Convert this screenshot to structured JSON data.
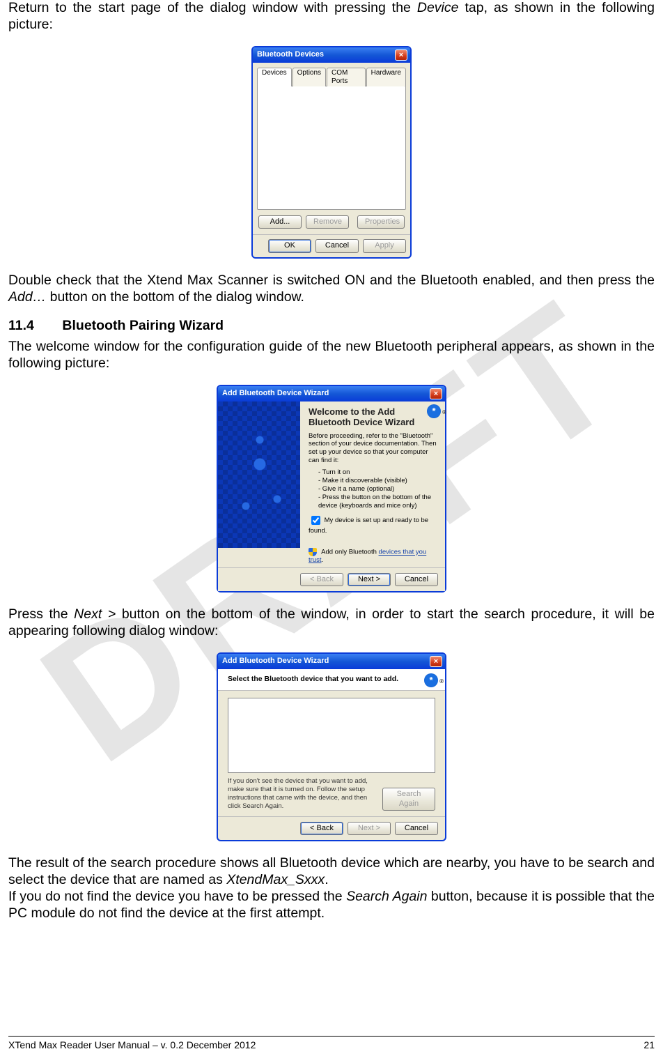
{
  "paragraphs": {
    "p1a": "Return to the start page of the dialog window with pressing the ",
    "p1b": "Device",
    "p1c": " tap, as shown in the following picture:",
    "p2a": "Double check that the Xtend Max Scanner is switched ON and the Bluetooth enabled, and then press the ",
    "p2b": "Add…",
    "p2c": " button on the bottom of the dialog window.",
    "p3": "The welcome window for the configuration guide of the new Bluetooth peripheral appears, as shown in the following picture:",
    "p4a": "Press the ",
    "p4b": "Next >",
    "p4c": " button on the bottom of the window, in order to start the search procedure, it will be appearing following dialog window:",
    "p5a": "The result of the search procedure shows all Bluetooth device which are nearby, you have to be search and select the device that are named as ",
    "p5b": "XtendMax_Sxxx",
    "p5c": ".",
    "p6a": "If you do not find the device you have to be pressed the ",
    "p6b": "Search Again",
    "p6c": " button, because it is possible that the PC module do not find the device at the first attempt."
  },
  "section": {
    "num": "11.4",
    "title": "Bluetooth Pairing Wizard"
  },
  "fig1": {
    "title": "Bluetooth Devices",
    "tabs": [
      "Devices",
      "Options",
      "COM Ports",
      "Hardware"
    ],
    "buttons": {
      "add": "Add...",
      "remove": "Remove",
      "properties": "Properties",
      "ok": "OK",
      "cancel": "Cancel",
      "apply": "Apply"
    }
  },
  "fig2": {
    "title": "Add Bluetooth Device Wizard",
    "heading": "Welcome to the Add Bluetooth Device Wizard",
    "intro": "Before proceeding, refer to the \"Bluetooth\" section of your device documentation. Then set up your device so that your computer can find it:",
    "bullets": [
      "- Turn it on",
      "- Make it discoverable (visible)",
      "- Give it a name (optional)",
      "- Press the button on the bottom of the device (keyboards and mice only)"
    ],
    "checkbox": "My device is set up and ready to be found.",
    "trustA": "Add only Bluetooth ",
    "trustLink": "devices that you trust",
    "trustB": ".",
    "buttons": {
      "back": "< Back",
      "next": "Next >",
      "cancel": "Cancel"
    }
  },
  "fig3": {
    "title": "Add Bluetooth Device Wizard",
    "header": "Select the Bluetooth device that you want to add.",
    "hint": "If you don't see the device that you want to add, make sure that it is turned on. Follow the setup instructions that came with the device, and then click Search Again.",
    "buttons": {
      "search": "Search Again",
      "back": "< Back",
      "next": "Next >",
      "cancel": "Cancel"
    }
  },
  "footer": {
    "left": "XTend Max Reader User Manual – v. 0.2 December 2012",
    "right": "21"
  }
}
